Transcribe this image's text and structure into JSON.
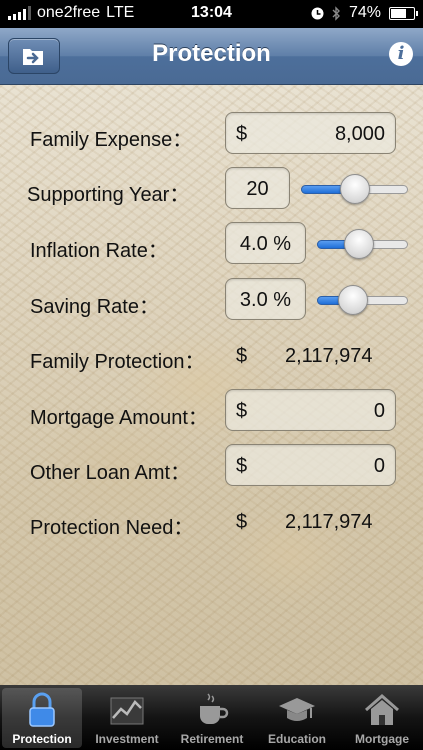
{
  "status_bar": {
    "carrier": "one2free",
    "network": "LTE",
    "time": "13:04",
    "battery_percent": "74%",
    "battery_level": 0.74
  },
  "nav": {
    "title": "Protection",
    "left_icon": "export-icon",
    "right_icon": "info-icon",
    "info_glyph": "i"
  },
  "form": {
    "family_expense": {
      "label": "Family Expense：",
      "currency": "$",
      "value": "8,000"
    },
    "supporting_year": {
      "label": "Supporting Year：",
      "value": "20",
      "slider_level": 0.5
    },
    "inflation_rate": {
      "label": "Inflation Rate：",
      "value": "4.0 %",
      "slider_level": 0.45
    },
    "saving_rate": {
      "label": "Saving Rate：",
      "value": "3.0 %",
      "slider_level": 0.35
    },
    "family_protection": {
      "label": "Family Protection：",
      "currency": "$",
      "value": "2,117,974"
    },
    "mortgage_amount": {
      "label": "Mortgage Amount：",
      "currency": "$",
      "value": "0"
    },
    "other_loan_amt": {
      "label": "Other Loan Amt：",
      "currency": "$",
      "value": "0"
    },
    "protection_need": {
      "label": "Protection Need：",
      "currency": "$",
      "value": "2,117,974"
    }
  },
  "tabs": [
    {
      "label": "Protection",
      "icon": "lock-icon",
      "active": true
    },
    {
      "label": "Investment",
      "icon": "chart-icon",
      "active": false
    },
    {
      "label": "Retirement",
      "icon": "coffee-cup-icon",
      "active": false
    },
    {
      "label": "Education",
      "icon": "graduation-cap-icon",
      "active": false
    },
    {
      "label": "Mortgage",
      "icon": "house-icon",
      "active": false
    }
  ],
  "colors": {
    "nav_accent": "#4d6f9b",
    "slider_fill": "#1f6fd8"
  }
}
